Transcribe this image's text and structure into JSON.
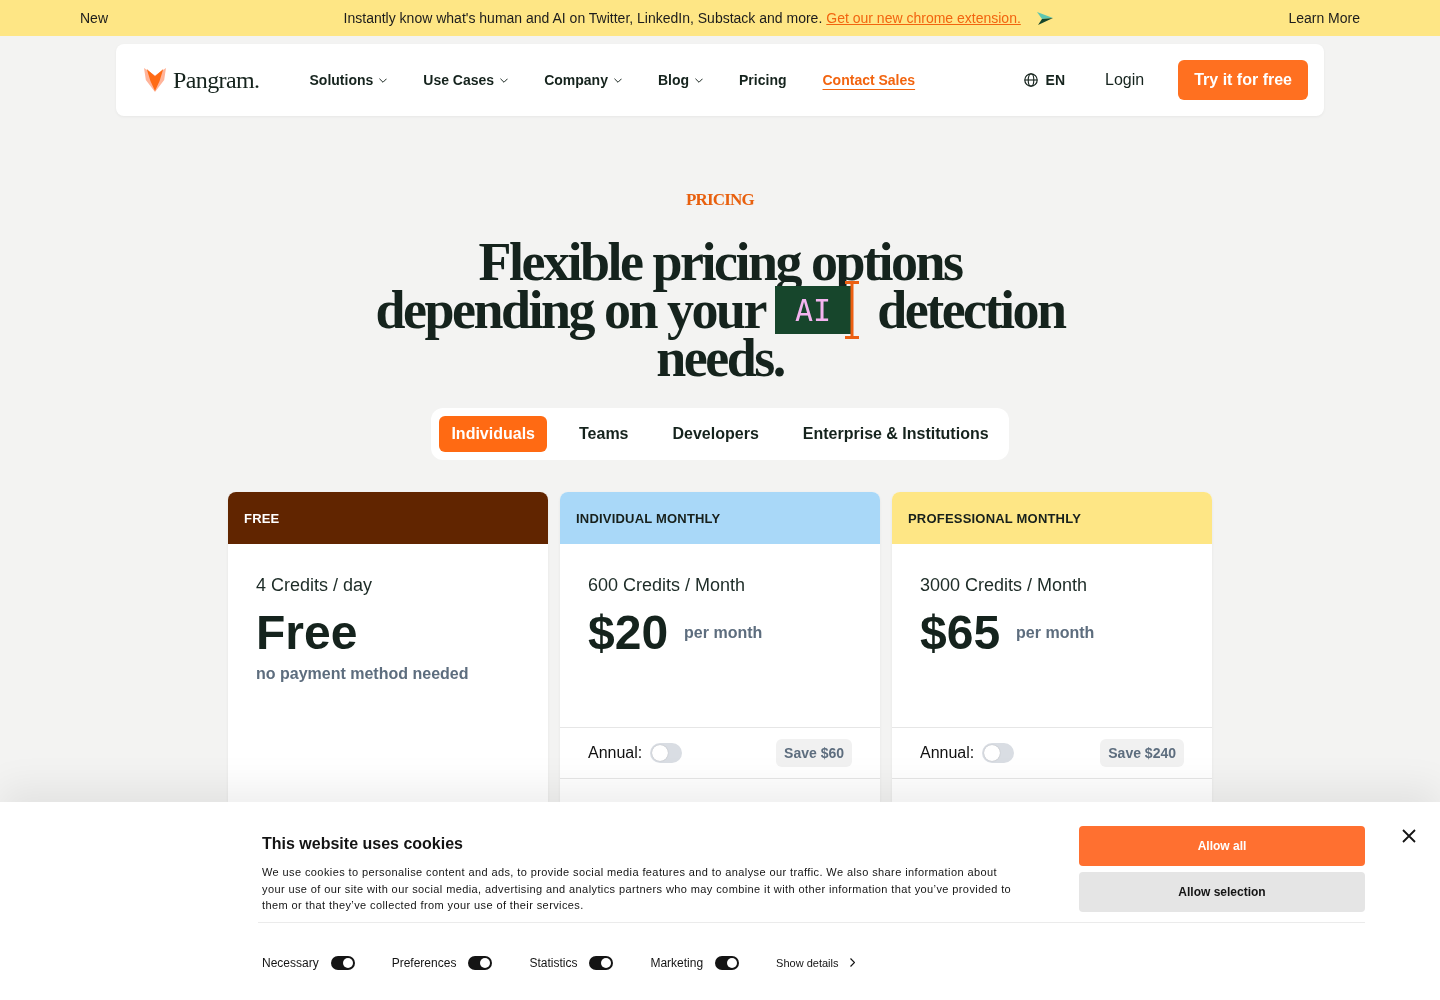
{
  "announcement": {
    "badge": "New",
    "message": "Instantly know what's human and AI on Twitter, LinkedIn, Substack and more.",
    "link": "Get our new chrome extension.",
    "learn_more": "Learn More"
  },
  "nav": {
    "logo": "Pangram.",
    "items": [
      {
        "label": "Solutions",
        "kind": "menu"
      },
      {
        "label": "Use Cases",
        "kind": "menu"
      },
      {
        "label": "Company",
        "kind": "menu"
      },
      {
        "label": "Blog",
        "kind": "menu"
      },
      {
        "label": "Pricing",
        "kind": "link"
      },
      {
        "label": "Contact Sales",
        "kind": "accent"
      }
    ],
    "language": "EN",
    "login": "Login",
    "cta": "Try it for free"
  },
  "hero": {
    "eyebrow": "PRICING",
    "title_lines": [
      {
        "text": "Flexible pricing options"
      },
      {
        "text": "depending on your",
        "highlight": "AI",
        "after": "detection"
      },
      {
        "text": "needs."
      }
    ]
  },
  "tabs": [
    {
      "label": "Individuals",
      "selected": true
    },
    {
      "label": "Teams",
      "selected": false
    },
    {
      "label": "Developers",
      "selected": false
    },
    {
      "label": "Enterprise & Institutions",
      "selected": false
    }
  ],
  "plans": [
    {
      "name": "FREE",
      "color": "#612500",
      "credits": "4 Credits / day",
      "price": "Free",
      "note": "no payment method needed"
    },
    {
      "name": "INDIVIDUAL MONTHLY",
      "color": "#a9d8f8",
      "credits": "600 Credits / Month",
      "price": "$20",
      "period": "per month",
      "annual": {
        "label": "Annual:",
        "on": false,
        "savings": "Save $60"
      }
    },
    {
      "name": "PROFESSIONAL MONTHLY",
      "color": "#fee685",
      "credits": "3000 Credits / Month",
      "price": "$65",
      "period": "per month",
      "annual": {
        "label": "Annual:",
        "on": false,
        "savings": "Save $240"
      }
    }
  ],
  "cookie_banner": {
    "title": "This website uses cookies",
    "description": "We use cookies to personalise content and ads, to provide social media features and to analyse our traffic. We also share information about your use of our site with our social media, advertising and analytics partners who may combine it with other information that you’ve provided to them or that they’ve collected from your use of their services.",
    "buttons": [
      {
        "label": "Allow all",
        "kind": "primary"
      },
      {
        "label": "Allow selection",
        "kind": "secondary"
      }
    ],
    "toggles": [
      {
        "label": "Necessary",
        "on": true
      },
      {
        "label": "Preferences",
        "on": true
      },
      {
        "label": "Statistics",
        "on": true
      },
      {
        "label": "Marketing",
        "on": true
      }
    ],
    "details": "Show details"
  }
}
